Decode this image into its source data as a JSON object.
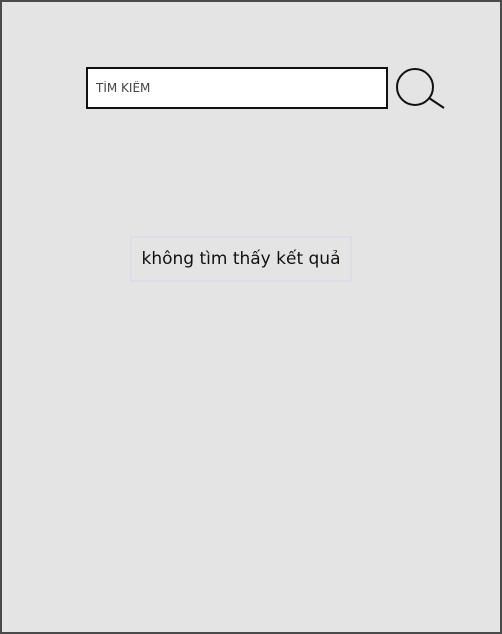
{
  "search": {
    "placeholder": "TÌM KIẾM",
    "value": "",
    "button_icon": "search-icon"
  },
  "results": {
    "empty_message": "không tìm thấy kết quả"
  },
  "colors": {
    "background": "#e4e4e4",
    "border": "#4a4a4a",
    "input_background": "#ffffff",
    "text": "#111111"
  }
}
